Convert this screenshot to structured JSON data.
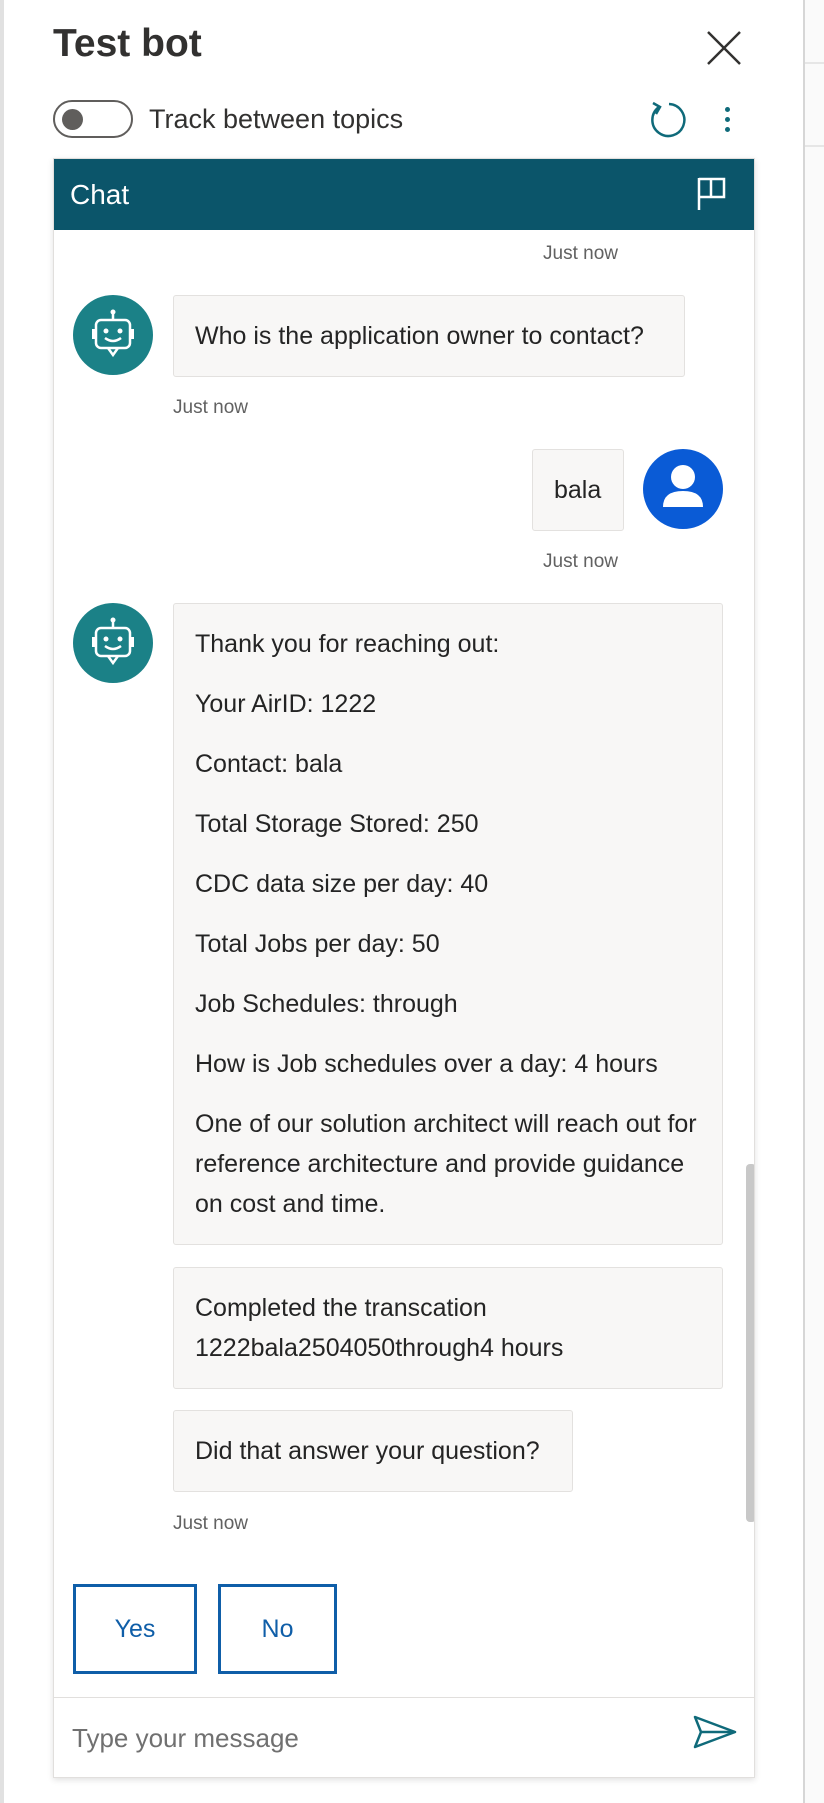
{
  "header": {
    "title": "Test bot",
    "toggle_label": "Track between topics",
    "toggle_on": false
  },
  "chat": {
    "header_title": "Chat",
    "top_timestamp": "Just now",
    "messages": [
      {
        "from": "bot",
        "text": "Who is the application owner to contact?",
        "timestamp": "Just now"
      },
      {
        "from": "user",
        "text": "bala",
        "timestamp": "Just now"
      },
      {
        "from": "bot",
        "lines": [
          "Thank you for reaching out:",
          "Your AirID: 1222",
          "Contact: bala",
          "Total Storage Stored: 250",
          "CDC data size per day: 40",
          "Total Jobs per day: 50",
          "Job Schedules: through",
          "How is Job schedules over a day: 4 hours",
          "One of our solution architect will reach out for reference architecture and provide guidance on cost and time."
        ]
      },
      {
        "from": "bot",
        "text": "Completed the transcation 1222bala2504050through4 hours"
      },
      {
        "from": "bot",
        "text": "Did that answer your question?",
        "timestamp": "Just now"
      }
    ],
    "quick_replies": [
      "Yes",
      "No"
    ],
    "input_placeholder": "Type your message",
    "input_value": ""
  },
  "colors": {
    "chat_header": "#0b556a",
    "bot_avatar": "#1b8187",
    "user_avatar": "#0a5bd6",
    "reply_button": "#0f5ea8"
  },
  "icons": {
    "close": "close-icon",
    "restart": "restart-icon",
    "more": "more-vertical-icon",
    "flag": "flag-icon",
    "bot": "bot-icon",
    "user": "user-icon",
    "send": "send-icon"
  }
}
